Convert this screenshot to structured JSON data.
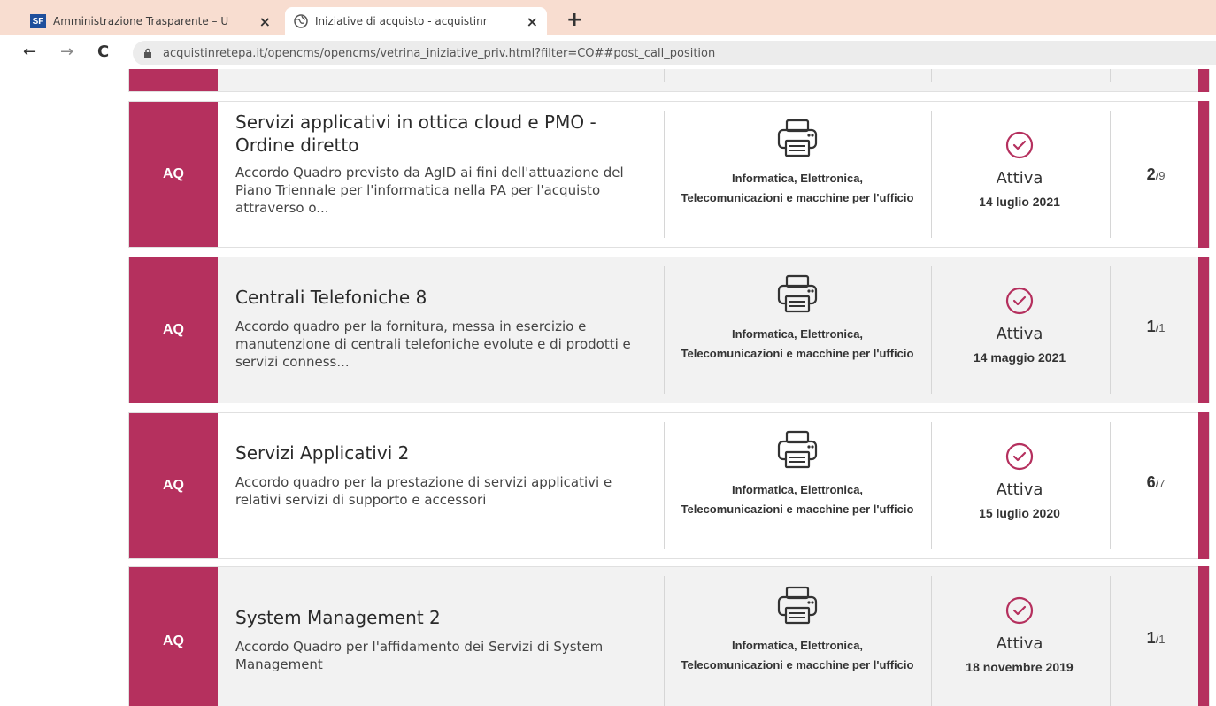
{
  "browser": {
    "tabs": [
      {
        "favicon": "SF",
        "title": "Amministrazione Trasparente – U",
        "close": "×"
      },
      {
        "favicon": "globe-icon",
        "title": "Iniziative di acquisto - acquistinr",
        "close": "×"
      }
    ],
    "new_tab": "+",
    "back": "←",
    "forward": "→",
    "reload": "C",
    "url": "acquistinretepa.it/opencms/opencms/vetrina_iniziative_priv.html?filter=CO##post_call_position"
  },
  "colors": {
    "accent": "#b5305e"
  },
  "cards": [
    {
      "badge": "AQ",
      "title": "Servizi applicativi in ottica cloud e PMO - Ordine diretto",
      "description": "Accordo Quadro previsto da AgID ai fini dell'attuazione del Piano Triennale per l'informatica nella PA per l'acquisto attraverso o...",
      "category": "Informatica, Elettronica, Telecomunicazioni e macchine per l'ufficio",
      "status": "Attiva",
      "date": "14 luglio 2021",
      "count": "2",
      "total": "/9"
    },
    {
      "badge": "AQ",
      "title": "Centrali Telefoniche 8",
      "description": "Accordo quadro per la fornitura, messa in esercizio e manutenzione di centrali telefoniche evolute e di prodotti e servizi conness...",
      "category": "Informatica, Elettronica, Telecomunicazioni e macchine per l'ufficio",
      "status": "Attiva",
      "date": "14 maggio 2021",
      "count": "1",
      "total": "/1"
    },
    {
      "badge": "AQ",
      "title": "Servizi Applicativi 2",
      "description": "Accordo quadro per la prestazione di servizi applicativi e relativi servizi di supporto e accessori",
      "category": "Informatica, Elettronica, Telecomunicazioni e macchine per l'ufficio",
      "status": "Attiva",
      "date": "15 luglio 2020",
      "count": "6",
      "total": "/7"
    },
    {
      "badge": "AQ",
      "title": "System Management 2",
      "description": "Accordo Quadro per l'affidamento dei Servizi di System Management",
      "category": "Informatica, Elettronica, Telecomunicazioni e macchine per l'ufficio",
      "status": "Attiva",
      "date": "18 novembre 2019",
      "count": "1",
      "total": "/1"
    }
  ]
}
